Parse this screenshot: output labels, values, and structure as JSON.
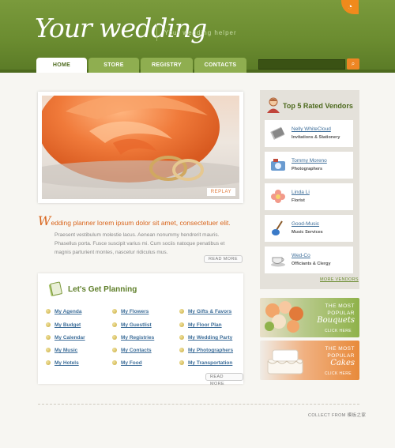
{
  "header": {
    "logo": "Your wedding",
    "tagline": "Your wedding helper",
    "rss_icon": "rss-icon",
    "search": {
      "placeholder": "",
      "button_icon": "search-icon"
    }
  },
  "nav": {
    "tabs": [
      {
        "label": "HOME",
        "active": true
      },
      {
        "label": "STORE",
        "active": false
      },
      {
        "label": "REGISTRY",
        "active": false
      },
      {
        "label": "CONTACTS",
        "active": false
      }
    ]
  },
  "hero": {
    "replay_label": "REPLAY",
    "image": "rose-and-rings"
  },
  "intro": {
    "title_initial": "W",
    "title_rest": "edding planner lorem ipsum dolor sit amet, consectetuer elit.",
    "text": "Praesent vestibulum molestie lacus. Aenean nonummy hendrerit mauris. Phasellus porta. Fusce suscipit varius mi. Cum sociis natoque penatibus et magnis parturient montes, nascetur ridiculus mus.",
    "more_label": "READ MORE"
  },
  "planning": {
    "title": "Let's Get Planning",
    "columns": [
      [
        "My Agenda",
        "My Budget",
        "My Calendar",
        "My Music",
        "My Hotels"
      ],
      [
        "My Flowers",
        "My Guestlist",
        "My Registries",
        "My Contacts",
        "My Food"
      ],
      [
        "My Gifts & Favors",
        "My Floor Plan",
        "My Wedding Party",
        "My Photographers",
        "My Transportation"
      ]
    ],
    "more_label": "READ MORE"
  },
  "vendors": {
    "title": "Top 5 Rated Vendors",
    "items": [
      {
        "name": "Nelly WhiteCloud",
        "role": "Invitations & Stationery",
        "icon": "invitation-icon"
      },
      {
        "name": "Tommy Moreno",
        "role": "Photographers",
        "icon": "camera-icon"
      },
      {
        "name": "Linda Li",
        "role": "Florist",
        "icon": "flower-icon"
      },
      {
        "name": "Good-Music",
        "role": "Music Services",
        "icon": "guitar-icon"
      },
      {
        "name": "Wed-Co",
        "role": "Officiants & Clergy",
        "icon": "teacup-icon"
      }
    ],
    "more_label": "MORE VENDORS"
  },
  "banners": [
    {
      "small": "THE MOST POPULAR",
      "large": "Bouquets",
      "click": "CLICK HERE",
      "color": "#8fb24a"
    },
    {
      "small": "THE MOST POPULAR",
      "large": "Cakes",
      "click": "CLICK HERE",
      "color": "#e88a3a"
    }
  ],
  "footer": {
    "text": "COLLECT FROM 模板之家"
  }
}
